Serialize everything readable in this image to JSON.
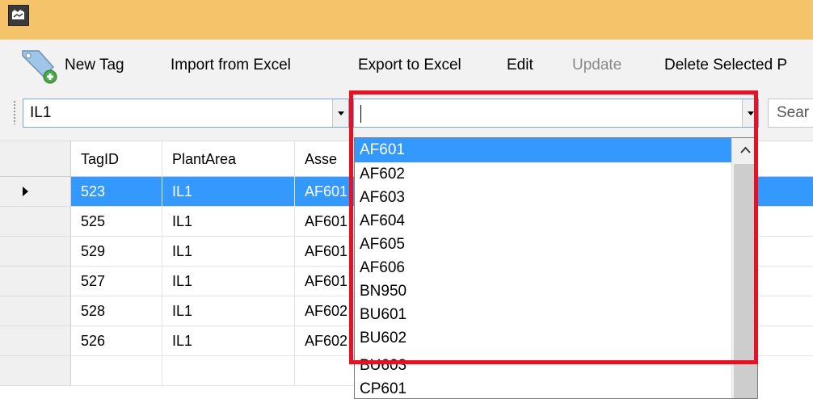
{
  "toolbar": {
    "new_tag": "New Tag",
    "import_excel": "Import from Excel",
    "export_excel": "Export to Excel",
    "edit": "Edit",
    "update": "Update",
    "delete_selected": "Delete Selected P"
  },
  "filters": {
    "plant_area_value": "IL1",
    "asset_value": "",
    "search_placeholder": "Sear"
  },
  "grid": {
    "columns": [
      "TagID",
      "PlantArea",
      "Asse"
    ],
    "rows": [
      {
        "tag_id": "523",
        "plant_area": "IL1",
        "asset": "AF601",
        "selected": true
      },
      {
        "tag_id": "525",
        "plant_area": "IL1",
        "asset": "AF601"
      },
      {
        "tag_id": "529",
        "plant_area": "IL1",
        "asset": "AF601"
      },
      {
        "tag_id": "527",
        "plant_area": "IL1",
        "asset": "AF601"
      },
      {
        "tag_id": "528",
        "plant_area": "IL1",
        "asset": "AF602"
      },
      {
        "tag_id": "526",
        "plant_area": "IL1",
        "asset": "AF602"
      }
    ]
  },
  "dropdown": {
    "items": [
      "AF601",
      "AF602",
      "AF603",
      "AF604",
      "AF605",
      "AF606",
      "BN950",
      "BU601",
      "BU602",
      "BU603",
      "CP601"
    ],
    "highlighted": "AF601"
  },
  "colors": {
    "title_bar": "#f5c46a",
    "selection": "#3399ff",
    "highlight_box": "#e81123"
  },
  "icons": {
    "app": "app-icon",
    "new_tag": "tag-add-icon",
    "dropdown_arrow": "chevron-down-icon",
    "scroll_up": "chevron-up-icon",
    "current_row": "row-pointer-icon"
  }
}
